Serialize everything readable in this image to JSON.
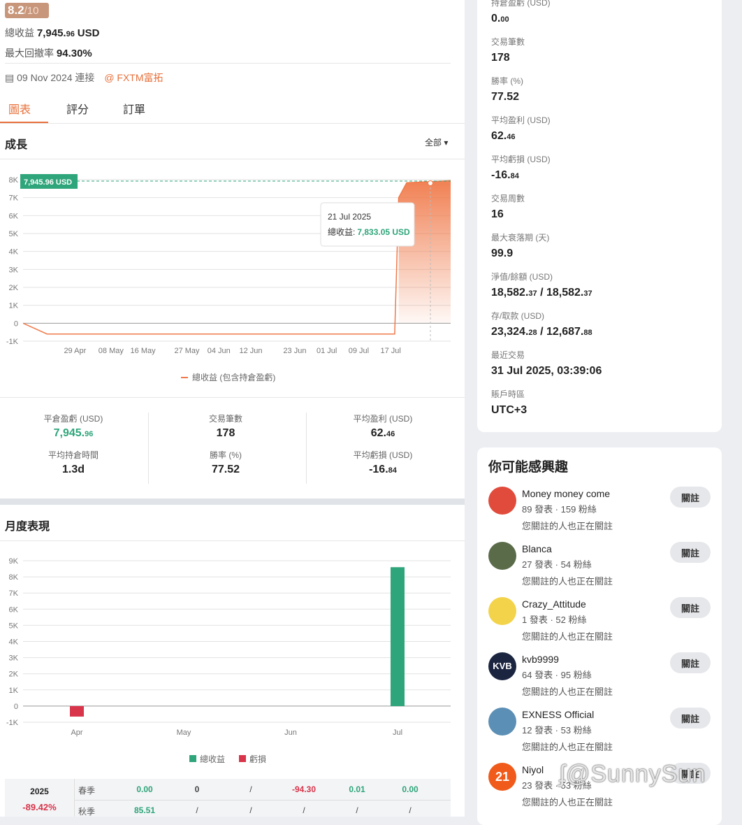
{
  "header": {
    "score": "8.2",
    "score_max": "/10",
    "total_profit_label": "總收益",
    "total_profit_main": "7,945.",
    "total_profit_dec": "96",
    "total_profit_unit": "USD",
    "max_drawdown_label": "最大回撤率",
    "max_drawdown_value": "94.30%",
    "connect_date": "09 Nov 2024 連接",
    "broker": "@ FXTM富拓"
  },
  "tabs": [
    {
      "label": "圖表"
    },
    {
      "label": "評分"
    },
    {
      "label": "訂單"
    }
  ],
  "growth": {
    "title": "成長",
    "filter": "全部",
    "tag": "7,945.96 USD",
    "tooltip_date": "21 Jul 2025",
    "tooltip_label": "總收益:",
    "tooltip_value": "7,833.05 USD",
    "legend": "總收益 (包含持倉盈虧)"
  },
  "chart_data": [
    {
      "type": "area",
      "y_ticks": [
        "8K",
        "7K",
        "6K",
        "5K",
        "4K",
        "3K",
        "2K",
        "1K",
        "0",
        "-1K"
      ],
      "x_ticks": [
        "29 Apr",
        "08 May",
        "16 May",
        "27 May",
        "04 Jun",
        "12 Jun",
        "23 Jun",
        "01 Jul",
        "09 Jul",
        "17 Jul"
      ],
      "ylim": [
        -1000,
        8000
      ],
      "series": [
        {
          "name": "總收益 (包含持倉盈虧)",
          "x": [
            "2025-04-20",
            "2025-04-22",
            "2025-07-18",
            "2025-07-19",
            "2025-07-21",
            "2025-07-31"
          ],
          "y": [
            0,
            -600,
            -600,
            7000,
            7833.05,
            7945.96
          ]
        }
      ],
      "color": "#f07a4a"
    },
    {
      "type": "bar",
      "categories": [
        "Apr",
        "May",
        "Jun",
        "Jul"
      ],
      "y_ticks": [
        "9K",
        "8K",
        "7K",
        "6K",
        "5K",
        "4K",
        "3K",
        "2K",
        "1K",
        "0",
        "-1K"
      ],
      "ylim": [
        -1000,
        9000
      ],
      "series": [
        {
          "name": "總收益",
          "values": [
            0,
            0,
            0,
            8600
          ],
          "color": "#2ea57a"
        },
        {
          "name": "虧損",
          "values": [
            -650,
            0,
            0,
            0
          ],
          "color": "#d8344a"
        }
      ]
    }
  ],
  "stats": [
    {
      "label": "平倉盈虧 (USD)",
      "main": "7,945.",
      "dec": "96",
      "green": true
    },
    {
      "label": "交易筆數",
      "main": "178",
      "dec": ""
    },
    {
      "label": "平均盈利 (USD)",
      "main": "62.",
      "dec": "46"
    },
    {
      "label": "平均持倉時間",
      "main": "1.3d",
      "dec": ""
    },
    {
      "label": "勝率 (%)",
      "main": "77.52",
      "dec": ""
    },
    {
      "label": "平均虧損 (USD)",
      "main": "-16.",
      "dec": "84"
    }
  ],
  "monthly": {
    "title": "月度表現",
    "legend_profit": "總收益",
    "legend_loss": "虧損",
    "table": {
      "year": "2025",
      "year_return": "-89.42%",
      "rows": [
        {
          "season": "春季",
          "cells": [
            "0.00",
            "0",
            "/",
            "-94.30",
            "0.01",
            "0.00"
          ]
        },
        {
          "season": "秋季",
          "cells": [
            "85.51",
            "/",
            "/",
            "/",
            "/",
            "/"
          ]
        }
      ]
    }
  },
  "right_stats": [
    {
      "label": "持倉盈虧 (USD)",
      "main": "0.",
      "dec": "00"
    },
    {
      "label": "交易筆數",
      "main": "178",
      "dec": ""
    },
    {
      "label": "勝率 (%)",
      "main": "77.52",
      "dec": ""
    },
    {
      "label": "平均盈利 (USD)",
      "main": "62.",
      "dec": "46"
    },
    {
      "label": "平均虧損 (USD)",
      "main": "-16.",
      "dec": "84"
    },
    {
      "label": "交易周數",
      "main": "16",
      "dec": ""
    },
    {
      "label": "最大衰落期 (天)",
      "main": "99.9",
      "dec": ""
    },
    {
      "label": "淨值/餘額 (USD)",
      "main": "18,582.",
      "dec": "37",
      "main2": " / 18,582.",
      "dec2": "37"
    },
    {
      "label": "存/取款 (USD)",
      "main": "23,324.",
      "dec": "28",
      "main2": " / 12,687.",
      "dec2": "88"
    },
    {
      "label": "最近交易",
      "main": "31 Jul 2025, 03:39:06",
      "dec": ""
    },
    {
      "label": "賬戶時區",
      "main": "UTC+3",
      "dec": ""
    }
  ],
  "suggestions": {
    "title": "你可能感興趣",
    "follow_label": "關註",
    "people": [
      {
        "name": "Money money come",
        "stats": "89 發表 · 159 粉絲",
        "note": "您關註的人也正在關註",
        "avatar_color": "#e14b3b"
      },
      {
        "name": "Blanca",
        "stats": "27 發表 · 54 粉絲",
        "note": "您關註的人也正在關註",
        "avatar_color": "#5a6b4a"
      },
      {
        "name": "Crazy_Attitude",
        "stats": "1 發表 · 52 粉絲",
        "note": "您關註的人也正在關註",
        "avatar_color": "#f3d34a"
      },
      {
        "name": "kvb9999",
        "stats": "64 發表 · 95 粉絲",
        "note": "您關註的人也正在關註",
        "avatar_color": "#1b2540",
        "avatar_text": "KVB"
      },
      {
        "name": "EXNESS Official",
        "stats": "12 發表 · 53 粉絲",
        "note": "您關註的人也正在關註",
        "avatar_color": "#5c8fb5"
      },
      {
        "name": "Niyol",
        "stats": "23 發表 · 53 粉絲",
        "note": "您關註的人也正在關註",
        "avatar_color": "#f05a1a",
        "avatar_text": "21"
      }
    ]
  },
  "watermark": "@SunnySun"
}
